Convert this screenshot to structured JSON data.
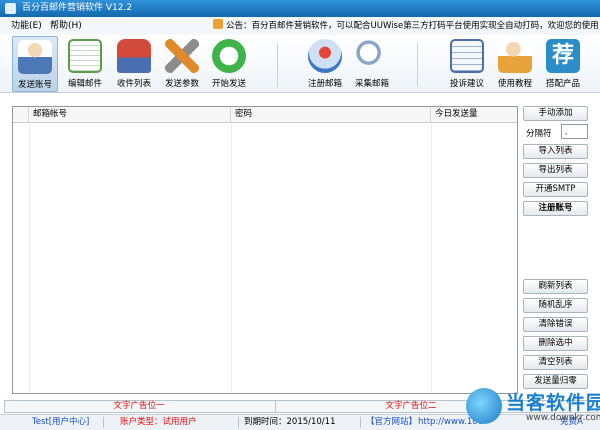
{
  "window": {
    "title": "百分百邮件营销软件  V12.2"
  },
  "menu": {
    "items": [
      "功能(E)",
      "帮助(H)"
    ]
  },
  "notice": {
    "text": "公告：百分百邮件营销软件，可以配合UUWise第三方打码平台使用实现全自动打码，欢迎您的使用！"
  },
  "toolbar": {
    "group1": [
      {
        "label": "发送账号",
        "icon": "user-account-icon",
        "color": "#6b8fc9"
      },
      {
        "label": "编辑邮件",
        "icon": "edit-mail-icon",
        "color": "#5a9e4b"
      },
      {
        "label": "收件列表",
        "icon": "mailbox-icon",
        "color": "#d24b3a"
      },
      {
        "label": "发送参数",
        "icon": "tools-icon",
        "color": "#e08a2c"
      },
      {
        "label": "开始发送",
        "icon": "start-send-icon",
        "color": "#3db34a"
      }
    ],
    "group2": [
      {
        "label": "注册邮箱",
        "icon": "register-mailbox-icon",
        "color": "#3a78c2"
      },
      {
        "label": "采集邮箱",
        "icon": "search-icon",
        "color": "#8aa6c7"
      }
    ],
    "group3": [
      {
        "label": "投诉建议",
        "icon": "notebook-icon",
        "color": "#4a6fb0"
      },
      {
        "label": "使用教程",
        "icon": "tutorial-user-icon",
        "color": "#e8a33a"
      },
      {
        "label": "搭配产品",
        "icon": "recommend-icon",
        "color": "#2b8dc8",
        "glyph": "荐"
      }
    ]
  },
  "table": {
    "columns": [
      "邮箱帐号",
      "密码",
      "今日发送量"
    ]
  },
  "sidebar": {
    "manual_add": "手动添加",
    "separator_label": "分隔符",
    "separator_value": ",",
    "import_list": "导入列表",
    "export_list": "导出列表",
    "enable_smtp": "开通SMTP",
    "register_account": "注册账号",
    "refresh_list": "刷新列表",
    "random_order": "随机乱序",
    "clear_errors": "清除错误",
    "delete_selected": "删除选中",
    "clear_list": "清空列表",
    "reset_send_count": "发送量归零"
  },
  "ads": {
    "slot1": "文字广告位一",
    "slot2": "文字广告位二"
  },
  "status": {
    "user": "Test[用户中心]",
    "account_type": "账户类型：试用用户",
    "expiry": "到期时间：2015/10/11",
    "official_site": "【官方网站】",
    "url": "http://www.100",
    "free_label": "免费A"
  },
  "watermark": {
    "title": "当客软件园",
    "url": "www.downkr.com"
  },
  "colors": {
    "titlebar": "#1f7dc4",
    "ad_text": "#e01010",
    "link": "#1a4fc4"
  }
}
